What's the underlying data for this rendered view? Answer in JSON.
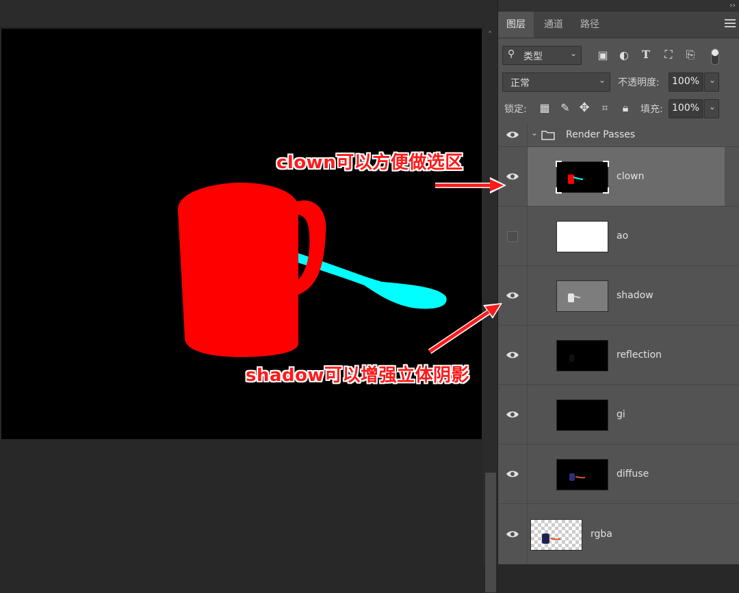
{
  "panel": {
    "collapse_icon": "double-chevron-icon",
    "tabs": [
      {
        "label": "图层",
        "active": true
      },
      {
        "label": "通道",
        "active": false
      },
      {
        "label": "路径",
        "active": false
      }
    ],
    "menu_icon": "hamburger-icon"
  },
  "filter": {
    "kind_label": "类型",
    "icons": [
      "image-filter-icon",
      "adjustment-filter-icon",
      "type-filter-icon",
      "shape-filter-icon",
      "smart-object-filter-icon",
      "filter-toggle-icon"
    ]
  },
  "blend": {
    "mode_value": "正常",
    "opacity_label": "不透明度:",
    "opacity_value": "100%"
  },
  "lock": {
    "label": "锁定:",
    "icons": [
      "lock-transparent-pixels-icon",
      "lock-image-pixels-icon",
      "lock-position-icon",
      "lock-artboard-icon",
      "lock-all-icon"
    ],
    "fill_label": "填充:",
    "fill_value": "100%"
  },
  "group": {
    "name": "Render Passes",
    "expanded": true,
    "visible": true
  },
  "layers": [
    {
      "name": "clown",
      "visible": true,
      "selected": true,
      "thumb": "clown"
    },
    {
      "name": "ao",
      "visible": false,
      "selected": false,
      "thumb": "white"
    },
    {
      "name": "shadow",
      "visible": true,
      "selected": false,
      "thumb": "gray"
    },
    {
      "name": "reflection",
      "visible": true,
      "selected": false,
      "thumb": "black"
    },
    {
      "name": "gi",
      "visible": true,
      "selected": false,
      "thumb": "black"
    },
    {
      "name": "diffuse",
      "visible": true,
      "selected": false,
      "thumb": "diffuse"
    },
    {
      "name": "rgba",
      "visible": true,
      "selected": false,
      "thumb": "checker"
    }
  ],
  "annotations": {
    "clown_note": "clown可以方便做选区",
    "shadow_note": "shadow可以增强立体阴影",
    "color": "#ff1a1a"
  },
  "canvas": {
    "background": "#000000",
    "mug_color": "#ff0000",
    "spoon_color": "#00ffff"
  }
}
